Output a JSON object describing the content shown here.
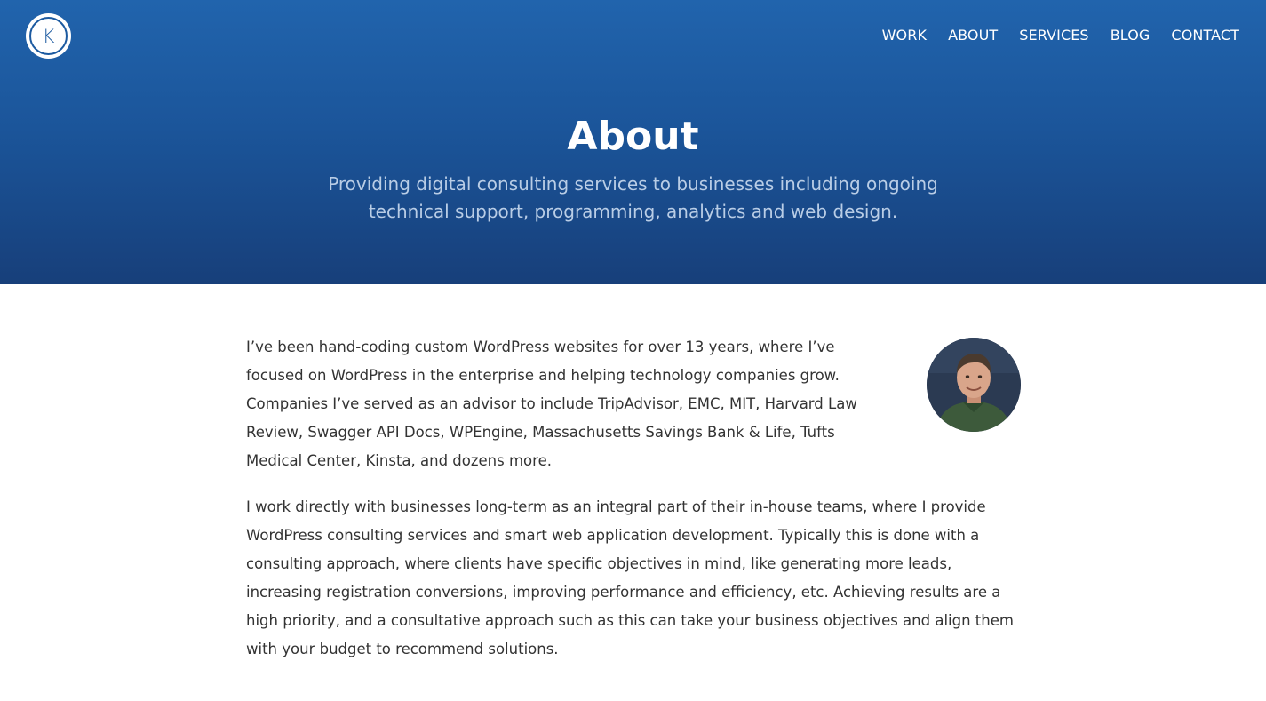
{
  "logo": {
    "letter": "K"
  },
  "nav": {
    "items": [
      {
        "label": "WORK"
      },
      {
        "label": "ABOUT"
      },
      {
        "label": "SERVICES"
      },
      {
        "label": "BLOG"
      },
      {
        "label": "CONTACT"
      }
    ]
  },
  "hero": {
    "title": "About",
    "subtitle": "Providing digital consulting services to businesses including ongoing technical support, programming, analytics and web design."
  },
  "content": {
    "paragraphs": [
      "I’ve been hand-coding custom WordPress websites for over 13 years, where I’ve focused on WordPress in the enterprise and helping technology companies grow. Companies I’ve served as an advisor to include TripAdvisor, EMC, MIT, Harvard Law Review, Swagger API Docs, WPEngine, Massachusetts Savings Bank & Life, Tufts Medical Center, Kinsta, and dozens more.",
      "I work directly with businesses long-term as an integral part of their in-house teams, where I provide WordPress consulting services and smart web application development. Typically this is done with a consulting approach, where clients have specific objectives in mind, like generating more leads, increasing registration conversions, improving performance and efficiency, etc. Achieving results are a high priority, and a consultative approach such as this can take your business objectives and align them with your budget to recommend solutions."
    ]
  },
  "colors": {
    "hero_top": "#2164ad",
    "hero_bottom": "#173f7a",
    "subtitle": "#b9cde6",
    "body_text": "#333333"
  }
}
